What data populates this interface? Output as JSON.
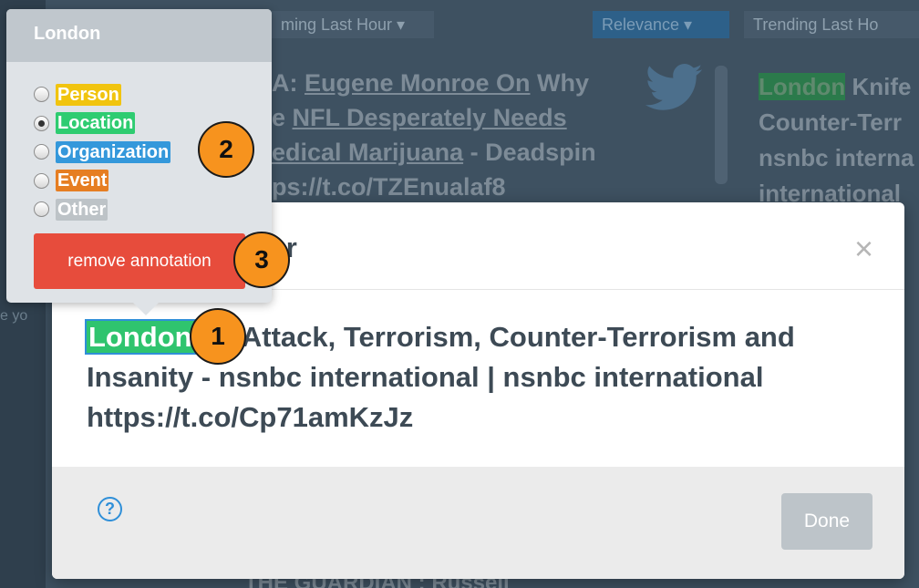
{
  "background": {
    "filter_left": "ming Last Hour ▾",
    "filter_sort": "Relevance ▾",
    "filter_right": "Trending Last Ho",
    "tweet_prefix": "A: ",
    "tweet_link1": "Eugene Monroe On",
    "tweet_mid1": " Why",
    "tweet_line2_pre": "e ",
    "tweet_link2": "NFL Desperately Needs",
    "tweet_link3": "edical Marijuana",
    "tweet_tail": " - Deadspin",
    "tweet_url": "ps://t.co/TZEnualaf8",
    "right_tag": "London",
    "right_line1": " Knife",
    "right_line2": "Counter-Terr",
    "right_line3": "nsnbc interna",
    "right_line4": "international",
    "bottom_text": "THE GUARDIAN : Russell",
    "side_text": "e yo"
  },
  "modal": {
    "title": "ditor",
    "close_glyph": "×",
    "annotated_word": "London",
    "tweet_rest": "fe Attack, Terrorism, Counter-Terrorism and Insanity - nsnbc international | nsnbc international https://t.co/Cp71amKzJz",
    "help_glyph": "?",
    "done_label": "Done"
  },
  "popover": {
    "title": "London",
    "options": [
      {
        "label": "Person",
        "color": "#f1c40f",
        "checked": false
      },
      {
        "label": "Location",
        "color": "#2ecc71",
        "checked": true
      },
      {
        "label": "Organization",
        "color": "#3498db",
        "checked": false
      },
      {
        "label": "Event",
        "color": "#e67e22",
        "checked": false
      },
      {
        "label": "Other",
        "color": "#bdc3c7",
        "checked": false
      }
    ],
    "remove_label": "remove annotation"
  },
  "callouts": [
    "1",
    "2",
    "3"
  ],
  "colors": {
    "accent": "#f7931e",
    "danger": "#e74c3c",
    "location_tag": "#2fc46e",
    "help": "#2f8fd8"
  }
}
